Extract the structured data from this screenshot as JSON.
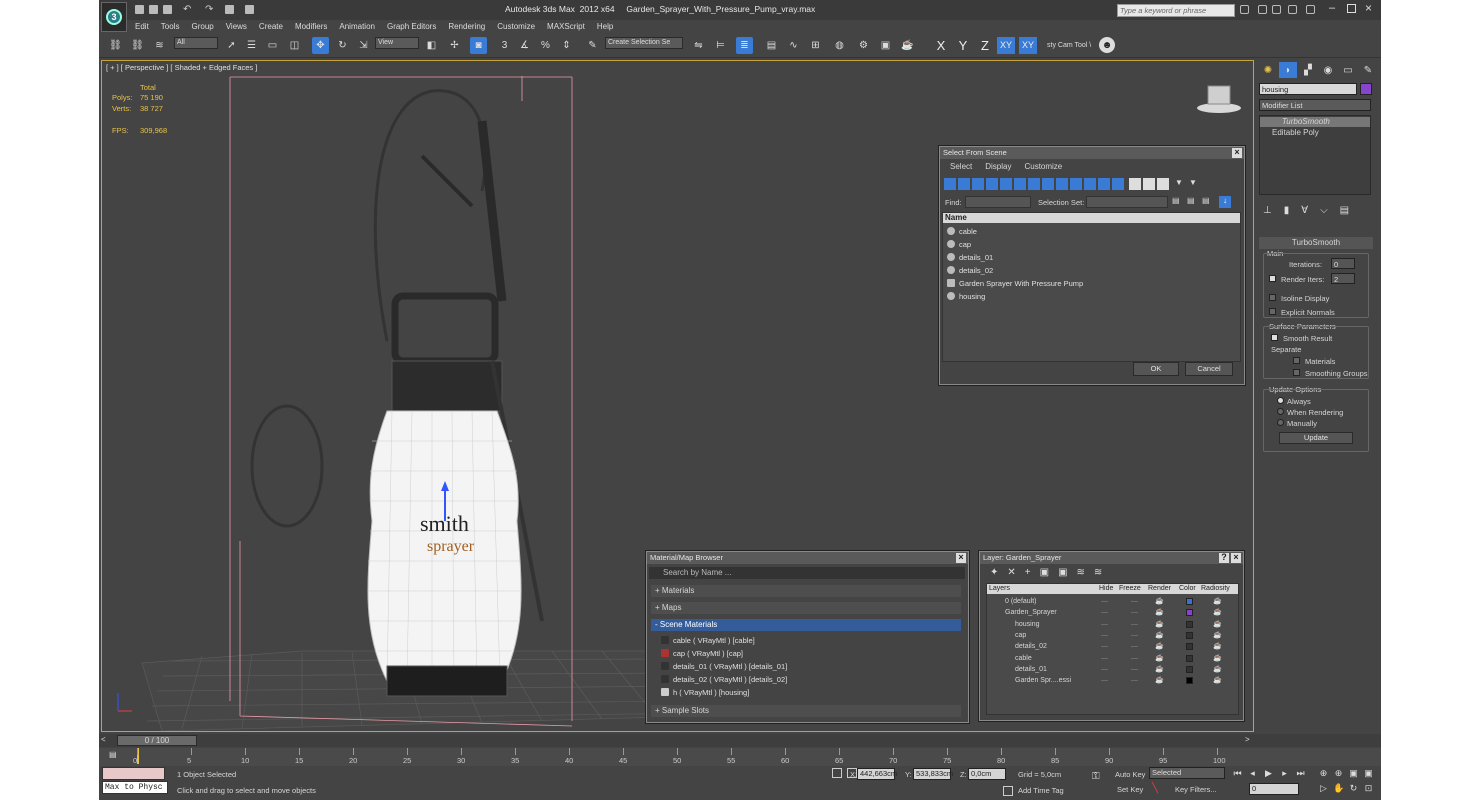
{
  "window": {
    "title": "Autodesk 3ds Max  2012 x64     Garden_Sprayer_With_Pressure_Pump_vray.max",
    "keyword_search_placeholder": "Type a keyword or phrase"
  },
  "menu": [
    "Edit",
    "Tools",
    "Group",
    "Views",
    "Create",
    "Modifiers",
    "Animation",
    "Graph Editors",
    "Rendering",
    "Customize",
    "MAXScript",
    "Help"
  ],
  "toolbar": {
    "selection_filter": "All",
    "reference_coord": "View",
    "named_selection_placeholder": "Create Selection Se",
    "axes": [
      "X",
      "Y",
      "Z",
      "XY",
      "XY"
    ],
    "custom_tool": "sty Cam Tool \\"
  },
  "viewport": {
    "label": "[ + ] [ Perspective ] [ Shaded + Edged Faces ]",
    "stats": {
      "header": "Total",
      "polys_label": "Polys:",
      "polys_value": "75 190",
      "verts_label": "Verts:",
      "verts_value": "38 727",
      "fps_label": "FPS:",
      "fps_value": "309,968"
    },
    "brand_line1": "smith",
    "brand_line2": "sprayer"
  },
  "command_panel": {
    "object_name": "housing",
    "modifier_list": "Modifier List",
    "stack": [
      "TurboSmooth",
      "Editable Poly"
    ],
    "rollout_title": "TurboSmooth",
    "main_label": "Main",
    "iterations_label": "Iterations:",
    "iterations_value": "0",
    "render_iters_label": "Render Iters:",
    "render_iters_value": "2",
    "isoline_display": "Isoline Display",
    "explicit_normals": "Explicit Normals",
    "surface_params": "Surface Parameters",
    "smooth_result": "Smooth Result",
    "separate": "Separate",
    "materials": "Materials",
    "smoothing_groups": "Smoothing Groups",
    "update_options": "Update Options",
    "always": "Always",
    "when_rendering": "When Rendering",
    "manually": "Manually",
    "update_button": "Update"
  },
  "select_from_scene": {
    "title": "Select From Scene",
    "menu": [
      "Select",
      "Display",
      "Customize"
    ],
    "find_label": "Find:",
    "selection_set_label": "Selection Set:",
    "column_name": "Name",
    "items": [
      "cable",
      "cap",
      "details_01",
      "details_02",
      "Garden Sprayer With Pressure Pump",
      "housing"
    ],
    "ok": "OK",
    "cancel": "Cancel"
  },
  "material_browser": {
    "title": "Material/Map Browser",
    "search_placeholder": "Search by Name ...",
    "groups": [
      "+ Materials",
      "+ Maps",
      "- Scene Materials",
      "+ Sample Slots"
    ],
    "scene_materials": [
      "cable  ( VRayMtl )  [cable]",
      "cap  ( VRayMtl )  [cap]",
      "details_01  ( VRayMtl )  [details_01]",
      "details_02  ( VRayMtl )  [details_02]",
      "h  ( VRayMtl )  [housing]"
    ]
  },
  "layer_dialog": {
    "title": "Layer: Garden_Sprayer",
    "columns": [
      "Layers",
      "Hide",
      "Freeze",
      "Render",
      "Color",
      "Radiosity"
    ],
    "rows": [
      "0 (default)",
      "Garden_Sprayer",
      "housing",
      "cap",
      "details_02",
      "cable",
      "details_01",
      "Garden Spr....essi"
    ],
    "colors": [
      "#3a6fd8",
      "#8a3fd0",
      "#333333",
      "#333333",
      "#333333",
      "#333333",
      "#333333",
      "#000000"
    ]
  },
  "timeline": {
    "frame_label": "0 / 100",
    "ticks": [
      "0",
      "5",
      "10",
      "15",
      "20",
      "25",
      "30",
      "35",
      "40",
      "45",
      "50",
      "55",
      "60",
      "65",
      "70",
      "75",
      "80",
      "85",
      "90",
      "95",
      "100"
    ]
  },
  "status": {
    "maxscript": "Max to Physc",
    "selected": "1 Object Selected",
    "prompt": "Click and drag to select and move objects",
    "x_label": "X:",
    "x_value": "442,663cm",
    "y_label": "Y:",
    "y_value": "533,833cm",
    "z_label": "Z:",
    "z_value": "0,0cm",
    "grid": "Grid = 5,0cm",
    "add_time_tag": "Add Time Tag",
    "auto_key": "Auto Key",
    "set_key": "Set Key",
    "key_selected": "Selected",
    "key_filters": "Key Filters...",
    "current_frame": "0"
  }
}
